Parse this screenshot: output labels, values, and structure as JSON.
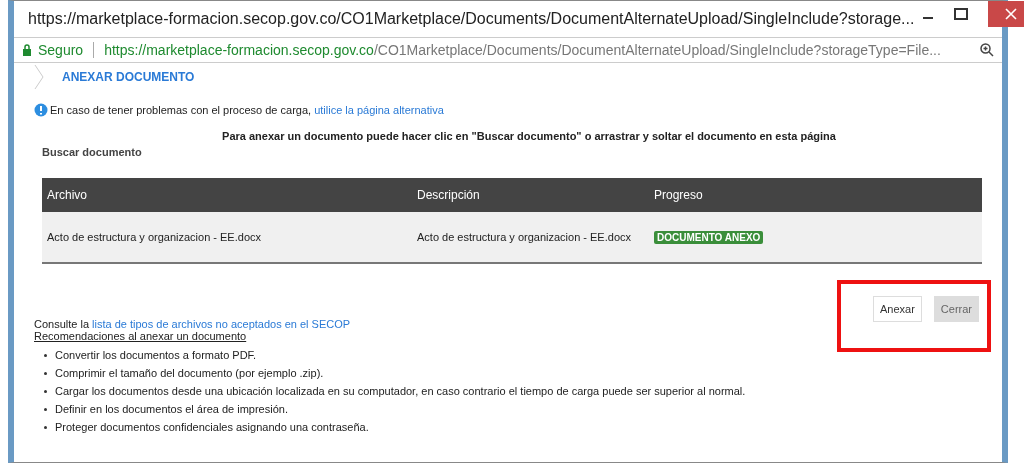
{
  "window": {
    "title": "https://marketplace-formacion.secop.gov.co/CO1Marketplace/Documents/DocumentAlternateUpload/SingleInclude?storage..."
  },
  "address_bar": {
    "security": "Seguro",
    "url_host": "https://marketplace-formacion.secop.gov.co",
    "url_path": "/CO1Marketplace/Documents/DocumentAlternateUpload/SingleInclude?storageType=File..."
  },
  "heading": "ANEXAR DOCUMENTO",
  "notice": {
    "text": "En caso de tener problemas con el proceso de carga,",
    "link": "utilice la página alternativa"
  },
  "instructions": "Para anexar un documento puede hacer clic en \"Buscar documento\" o arrastrar y soltar el documento en esta página",
  "search_link": "Buscar documento",
  "table": {
    "columns": [
      "Archivo",
      "Descripción",
      "Progreso"
    ],
    "rows": [
      {
        "file": "Acto de estructura y organizacion - EE.docx",
        "description": "Acto de estructura y organizacion - EE.docx",
        "progress": "DOCUMENTO ANEXO",
        "color": "#3a8e3a"
      }
    ]
  },
  "buttons": [
    {
      "label": "Anexar",
      "disabled": false
    },
    {
      "label": "Cerrar",
      "disabled": true
    }
  ],
  "highlight": true,
  "consult": {
    "text": "Consulte la",
    "link": "lista de tipos de archivos no aceptados en el SECOP"
  },
  "recommendations": {
    "title": "Recomendaciones al anexar un documento",
    "items": [
      "Convertir los documentos a formato PDF.",
      "Comprimir el tamaño del documento (por ejemplo .zip).",
      "Cargar los documentos desde una ubicación localizada en su computador, en caso contrario el tiempo de carga puede ser superior al normal.",
      "Definir en los documentos el área de impresión.",
      "Proteger documentos confidenciales asignando una contraseña."
    ]
  }
}
